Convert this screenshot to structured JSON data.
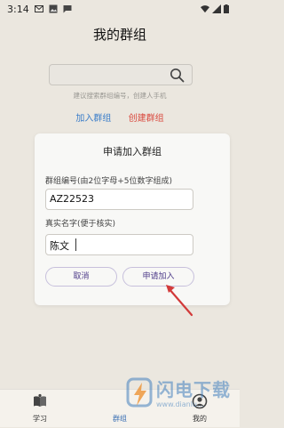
{
  "status_bar": {
    "time": "3:14"
  },
  "page": {
    "title": "我的群组"
  },
  "search": {
    "value": "",
    "hint": "建议搜索群组编号，创建人手机"
  },
  "actions": {
    "join_label": "加入群组",
    "create_label": "创建群组",
    "join_color": "#3a7dc9",
    "create_color": "#d9473c"
  },
  "dialog": {
    "title": "申请加入群组",
    "group_id_label": "群组编号(由2位字母+5位数字组成)",
    "group_id_value": "AZ22523",
    "real_name_label": "真实名字(便于核实)",
    "real_name_value": "陈文",
    "cancel_label": "取消",
    "apply_label": "申请加入"
  },
  "bottom_nav": {
    "items": [
      {
        "label": "学习",
        "icon": "book-icon"
      },
      {
        "label": "群组",
        "icon": "group-icon",
        "active": true
      },
      {
        "label": "我的",
        "icon": "user-icon"
      }
    ]
  },
  "watermark": {
    "brand": "闪电下载",
    "url": "www.dianlu..."
  }
}
